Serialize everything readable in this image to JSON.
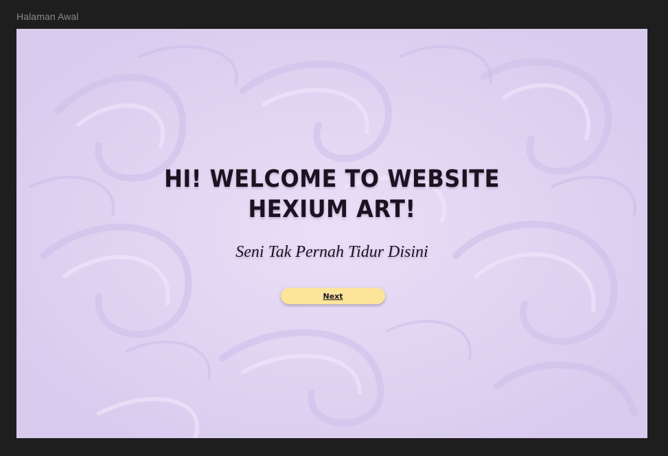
{
  "window": {
    "frame_label": "Halaman Awal"
  },
  "hero": {
    "headline_line1": "HI!  WELCOME TO WEBSITE",
    "headline_line2": "HEXIUM ART!",
    "tagline": "Seni Tak Pernah Tidur Disini",
    "next_label": "Next"
  },
  "colors": {
    "canvas_dark": "#1e1e1e",
    "lavender_bg": "#e2d6f3",
    "button_yellow": "#fde49b",
    "text_dark": "#1a1320"
  },
  "icons": {
    "background": "starry-night-swirl-pattern"
  }
}
